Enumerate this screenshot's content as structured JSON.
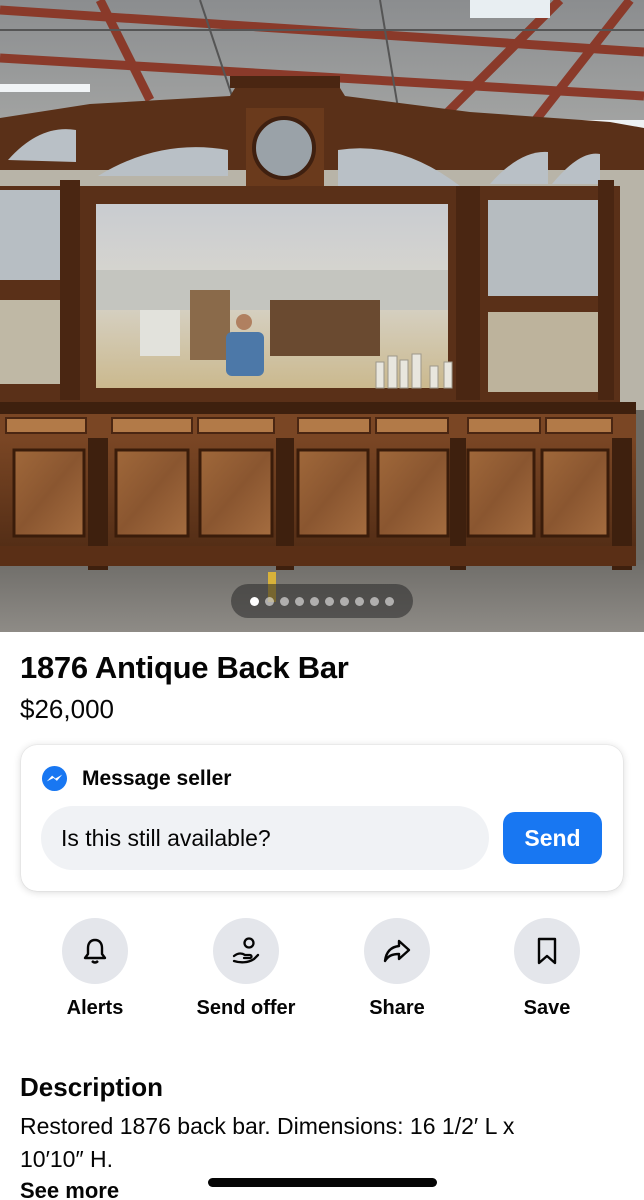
{
  "gallery": {
    "photo_alt": "Antique back bar",
    "dot_count": 10,
    "active_index": 0
  },
  "listing": {
    "title": "1876 Antique Back Bar",
    "price": "$26,000"
  },
  "message": {
    "label": "Message seller",
    "input_value": "Is this still available?",
    "send_label": "Send"
  },
  "actions": [
    {
      "label": "Alerts",
      "icon": "bell-icon"
    },
    {
      "label": "Send offer",
      "icon": "offer-icon"
    },
    {
      "label": "Share",
      "icon": "share-icon"
    },
    {
      "label": "Save",
      "icon": "bookmark-icon"
    }
  ],
  "description": {
    "heading": "Description",
    "text": "Restored 1876 back bar. Dimensions: 16 1/2′ L x 10′10″ H.",
    "see_more": "See more"
  },
  "colors": {
    "accent": "#1877f2",
    "wood": "#6b3d1f",
    "circle_bg": "#e4e6eb",
    "input_bg": "#f0f2f5"
  }
}
